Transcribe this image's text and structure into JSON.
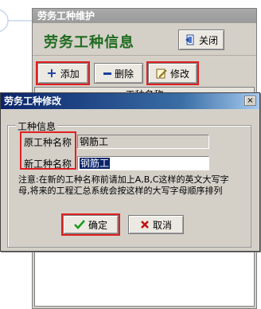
{
  "back_window": {
    "title": "劳务工种维护",
    "banner_title": "劳务工种信息",
    "close_label": "关闭",
    "toolbar": {
      "add_label": "添加",
      "delete_label": "删除",
      "edit_label": "修改"
    },
    "grid": {
      "column_header": "工种名称"
    }
  },
  "dialog": {
    "title": "劳务工种修改",
    "close_glyph": "×",
    "group_label": "工种信息",
    "fields": {
      "original_label": "原工种名称",
      "original_value": "钢筋工",
      "new_label": "新工种名称",
      "new_value": "钢筋工"
    },
    "note": "注意:在新的工种名称前请加上A,B,C这样的英文大写字母,将来的工程汇总系统会按这样的大写字母顺序排列",
    "buttons": {
      "ok_label": "确定",
      "cancel_label": "取消"
    }
  },
  "colors": {
    "highlight": "#e02020",
    "dialog_title_bg": "#0a246a",
    "banner_text": "#1f6b1f"
  }
}
